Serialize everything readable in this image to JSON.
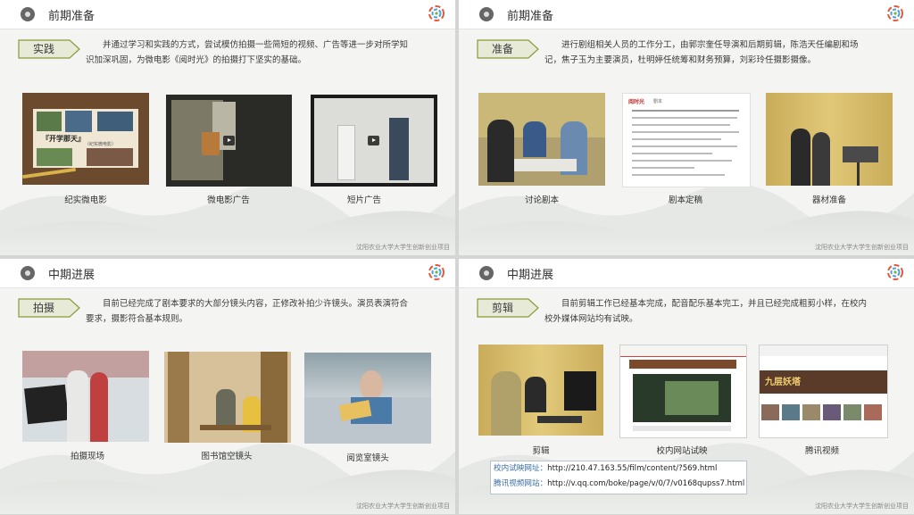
{
  "colors": {
    "tag_fill": "#e8ead8",
    "tag_border": "#8a9a3a",
    "link_label": "#3a6ea8"
  },
  "slides": [
    {
      "header": {
        "title": "前期准备",
        "icon": "disc-icon"
      },
      "tag": "实践",
      "desc": "并通过学习和实践的方式，尝试模仿拍摄一些简短的视频、广告等进一步对所学知识加深巩固，为微电影《阅时光》的拍摄打下坚实的基础。",
      "thumbs": [
        {
          "caption": "纪实微电影",
          "overlay": "『开学那天』",
          "overlay2": "（纪实微电影）"
        },
        {
          "caption": "微电影广告"
        },
        {
          "caption": "短片广告"
        }
      ],
      "footer": "沈阳农业大学大学生创新创业项目"
    },
    {
      "header": {
        "title": "前期准备",
        "icon": "disc-icon"
      },
      "tag": "准备",
      "desc": "进行剧组相关人员的工作分工，由郭宗奎任导演和后期剪辑，陈浩天任编剧和场记，焦子玉为主要演员，杜明婷任统筹和财务预算，刘彩玲任摄影摄像。",
      "thumbs": [
        {
          "caption": "讨论剧本"
        },
        {
          "caption": "剧本定稿",
          "doc_title": "阅时光",
          "doc_sub": "剧本"
        },
        {
          "caption": "器材准备"
        }
      ],
      "footer": "沈阳农业大学大学生创新创业项目"
    },
    {
      "header": {
        "title": "中期进展",
        "icon": "disc-icon"
      },
      "tag": "拍摄",
      "desc": "目前已经完成了剧本要求的大部分镜头内容，正修改补拍少许镜头。演员表演符合要求，摄影符合基本规则。",
      "thumbs": [
        {
          "caption": "拍摄现场"
        },
        {
          "caption": "图书馆空镜头"
        },
        {
          "caption": "阅览室镜头"
        }
      ],
      "footer": "沈阳农业大学大学生创新创业项目"
    },
    {
      "header": {
        "title": "中期进展",
        "icon": "disc-icon"
      },
      "tag": "剪辑",
      "desc": "目前剪辑工作已经基本完成，配音配乐基本完工，并且已经完成粗剪小样，在校内校外媒体网站均有试映。",
      "thumbs": [
        {
          "caption": "剪辑"
        },
        {
          "caption": "校内网站试映"
        },
        {
          "caption": "腾讯视频",
          "banner": "九层妖塔"
        }
      ],
      "links": [
        {
          "label": "校内试映网址：",
          "url": "http://210.47.163.55/film/content/?569.html"
        },
        {
          "label": "腾讯视频网站：",
          "url": "http://v.qq.com/boke/page/v/0/7/v0168qupss7.html"
        }
      ],
      "footer": "沈阳农业大学大学生创新创业项目"
    }
  ]
}
